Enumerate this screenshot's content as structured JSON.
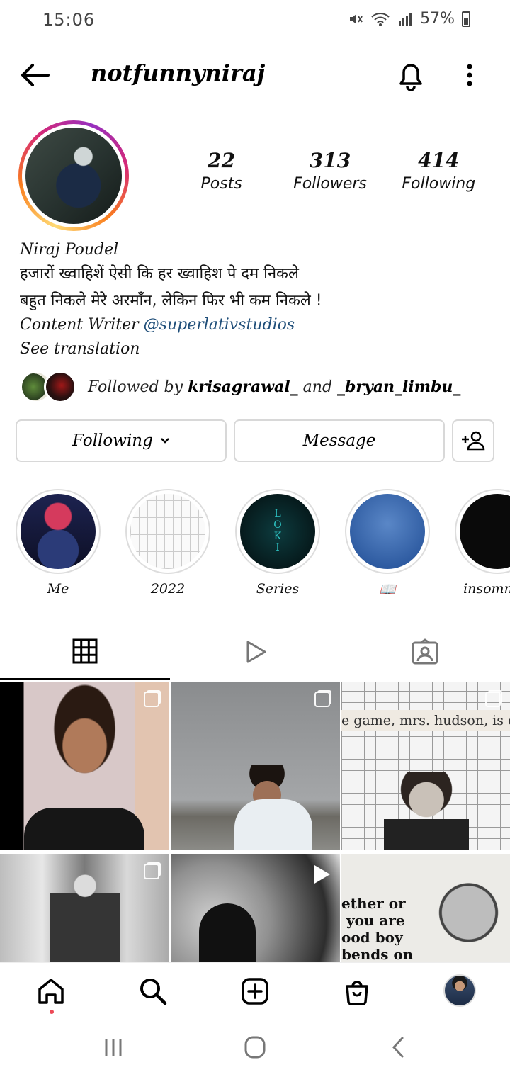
{
  "status": {
    "time": "15:06",
    "battery": "57%"
  },
  "header": {
    "username": "notfunnyniraj"
  },
  "stats": [
    {
      "value": "22",
      "label": "Posts"
    },
    {
      "value": "313",
      "label": "Followers"
    },
    {
      "value": "414",
      "label": "Following"
    }
  ],
  "bio": {
    "name": "Niraj Poudel",
    "line1": "हजारों ख्वाहिशें ऐसी कि हर ख्वाहिश पे दम निकले",
    "line2": "बहुत निकले मेरे अरमाँन, लेकिन फिर भी कम निकले !",
    "line3_prefix": "Content Writer ",
    "line3_link": "@superlativstudios",
    "translation": "See translation"
  },
  "followed_by": {
    "prefix": "Followed by ",
    "user1": "krisagrawal_",
    "middle": " and ",
    "user2": "_bryan_limbu_"
  },
  "actions": {
    "following": "Following",
    "message": "Message"
  },
  "highlights": [
    {
      "label": "Me"
    },
    {
      "label": "2022"
    },
    {
      "label": "Series",
      "cover_text": "LOKI"
    },
    {
      "label": "📖"
    },
    {
      "label": "insomn"
    }
  ],
  "posts": {
    "p3_text": "e game, mrs. hudson, is o",
    "p6_text": "ether or\n you are\nood boy\nbends on"
  },
  "icons": {
    "back": "arrow-left-icon",
    "bell": "bell-icon",
    "more": "more-vertical-icon",
    "chevron": "chevron-down-icon",
    "add_user": "add-user-icon",
    "grid": "grid-icon",
    "reels": "play-icon",
    "tagged": "tagged-icon",
    "home": "home-icon",
    "search": "search-icon",
    "create": "plus-square-icon",
    "shop": "shop-bag-icon"
  },
  "colors": {
    "link": "#1f4e79",
    "notification_dot": "#ed4956"
  }
}
